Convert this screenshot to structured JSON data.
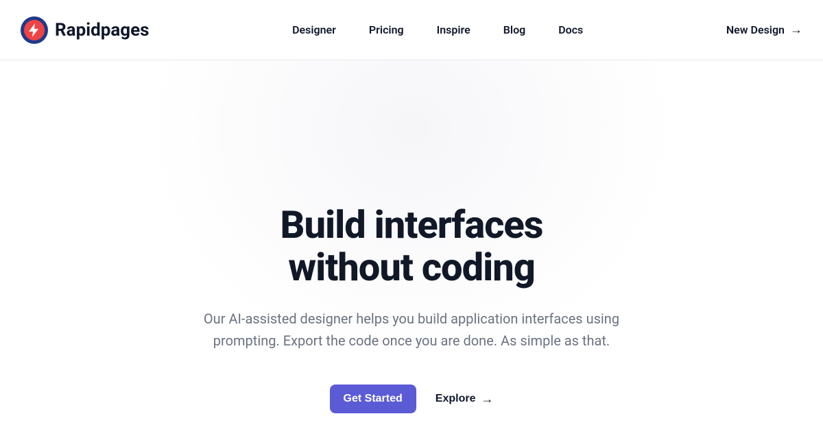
{
  "header": {
    "brand": "Rapidpages",
    "nav": [
      {
        "label": "Designer"
      },
      {
        "label": "Pricing"
      },
      {
        "label": "Inspire"
      },
      {
        "label": "Blog"
      },
      {
        "label": "Docs"
      }
    ],
    "cta_label": "New Design"
  },
  "hero": {
    "title_line1": "Build interfaces",
    "title_line2": "without coding",
    "subtitle": "Our AI-assisted designer helps you build application interfaces using prompting. Export the code once you are done. As simple as that.",
    "primary_button": "Get Started",
    "secondary_button": "Explore"
  }
}
